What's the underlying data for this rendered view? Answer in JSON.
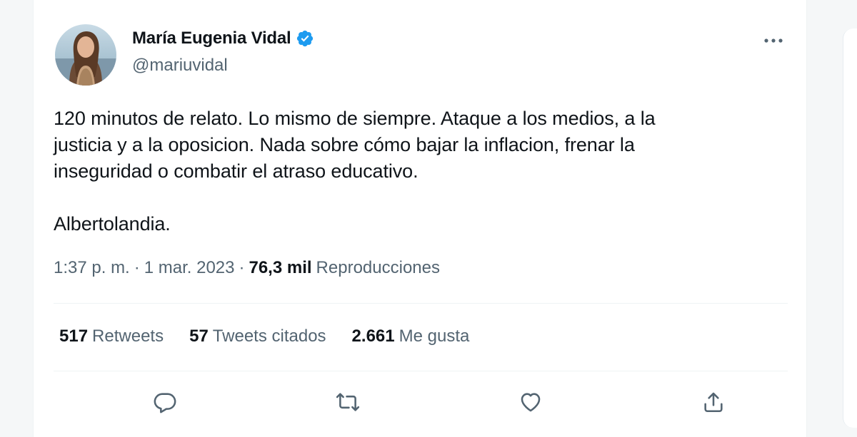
{
  "author": {
    "display_name": "María Eugenia Vidal",
    "handle": "@mariuvidal",
    "verified": true,
    "avatar_icon": "profile-photo"
  },
  "tweet": {
    "text": "120 minutos de relato. Lo mismo de siempre. Ataque a los medios, a la\njusticia y a la oposicion. Nada sobre cómo bajar la inflacion, frenar la\ninseguridad o combatir el atraso educativo.\n\nAlbertolandia."
  },
  "meta": {
    "time": "1:37 p. m.",
    "separator": "·",
    "date": "1 mar. 2023",
    "views_count": "76,3 mil",
    "views_label": "Reproducciones"
  },
  "stats": {
    "retweets": {
      "count": "517",
      "label": "Retweets"
    },
    "quotes": {
      "count": "57",
      "label": "Tweets citados"
    },
    "likes": {
      "count": "2.661",
      "label": "Me gusta"
    }
  },
  "actions": {
    "icons": [
      "reply-icon",
      "retweet-icon",
      "like-icon",
      "share-icon"
    ]
  },
  "colors": {
    "verified": "#1d9bf0",
    "secondary_text": "#536471",
    "primary_text": "#0f1419",
    "divider": "#eff3f4"
  }
}
